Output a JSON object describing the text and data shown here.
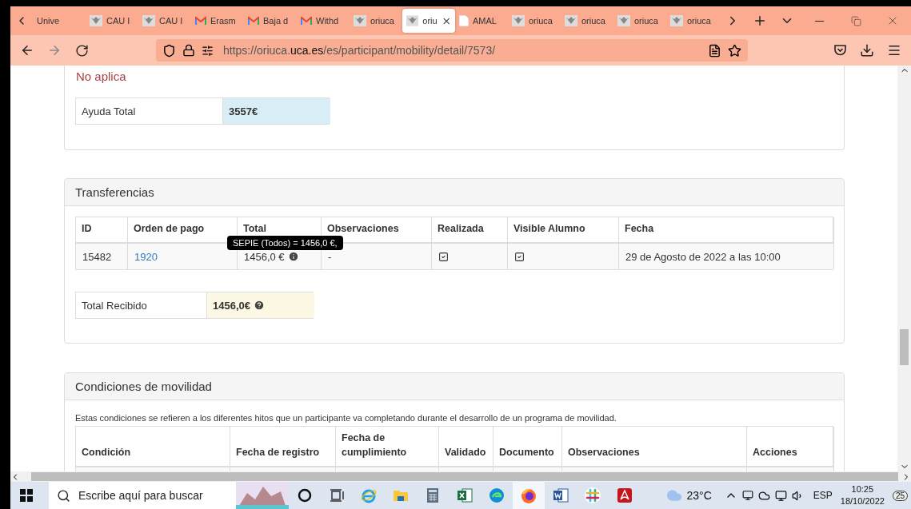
{
  "browser": {
    "tabs": [
      {
        "title": "Unive",
        "kind": "plain",
        "selected": false
      },
      {
        "title": "CAU I",
        "kind": "crest",
        "selected": false
      },
      {
        "title": "CAU I",
        "kind": "crest",
        "selected": false
      },
      {
        "title": "Erasm",
        "kind": "mail",
        "selected": false
      },
      {
        "title": "Baja d",
        "kind": "mail",
        "selected": false
      },
      {
        "title": "Withd",
        "kind": "mail",
        "selected": false
      },
      {
        "title": "oriuca",
        "kind": "crest",
        "selected": false
      },
      {
        "title": "oriu",
        "kind": "crest",
        "selected": true
      },
      {
        "title": "AMAL",
        "kind": "document",
        "selected": false
      },
      {
        "title": "oriuca",
        "kind": "crest",
        "selected": false
      },
      {
        "title": "oriuca",
        "kind": "crest",
        "selected": false
      },
      {
        "title": "oriuca",
        "kind": "crest",
        "selected": false
      },
      {
        "title": "oriuca",
        "kind": "crest",
        "selected": false
      }
    ],
    "url": {
      "scheme": "https://oriuca.",
      "host": "uca.es",
      "path": "/es/participant/mobility/detail/7573/"
    }
  },
  "page": {
    "notice": "No aplica",
    "aid": {
      "label": "Ayuda Total",
      "value": "3557€"
    },
    "transfers": {
      "title": "Transferencias",
      "columns": [
        "ID",
        "Orden de pago",
        "Total",
        "Observaciones",
        "Realizada",
        "Visible Alumno",
        "Fecha"
      ],
      "rows": [
        {
          "id": "15482",
          "order": "1920",
          "total": "1456,0 €",
          "observations": "-",
          "done": true,
          "visible": true,
          "date": "29 de Agosto de 2022 a las 10:00"
        }
      ],
      "tooltip": "SEPIE (Todos) = 1456,0 €,",
      "total_received": {
        "label": "Total Recibido",
        "value": "1456,0€"
      }
    },
    "conditions": {
      "title": "Condiciones de movilidad",
      "description": "Estas condiciones se refieren a los diferentes hitos que un participante va completando durante el desarrollo de un programa de movilidad.",
      "columns": [
        "Condición",
        "Fecha de registro",
        "Fecha de cumplimiento",
        "Validado",
        "Documento",
        "Observaciones",
        "Acciones"
      ]
    }
  },
  "taskbar": {
    "search_placeholder": "Escribe aquí para buscar",
    "apps": [
      {
        "kind": "cortana",
        "selected": false
      },
      {
        "kind": "taskview",
        "selected": false
      },
      {
        "kind": "ie",
        "selected": false
      },
      {
        "kind": "explorer",
        "selected": false
      },
      {
        "kind": "calculator",
        "selected": false
      },
      {
        "kind": "excel",
        "selected": false
      },
      {
        "kind": "edge",
        "selected": false
      },
      {
        "kind": "firefox",
        "selected": true
      },
      {
        "kind": "word",
        "selected": false
      },
      {
        "kind": "slack",
        "selected": false
      },
      {
        "kind": "acrobat",
        "selected": false
      }
    ],
    "temperature": "23°C",
    "language": "ESP",
    "time": "10:25",
    "date": "18/10/2022",
    "notifications": "25"
  }
}
